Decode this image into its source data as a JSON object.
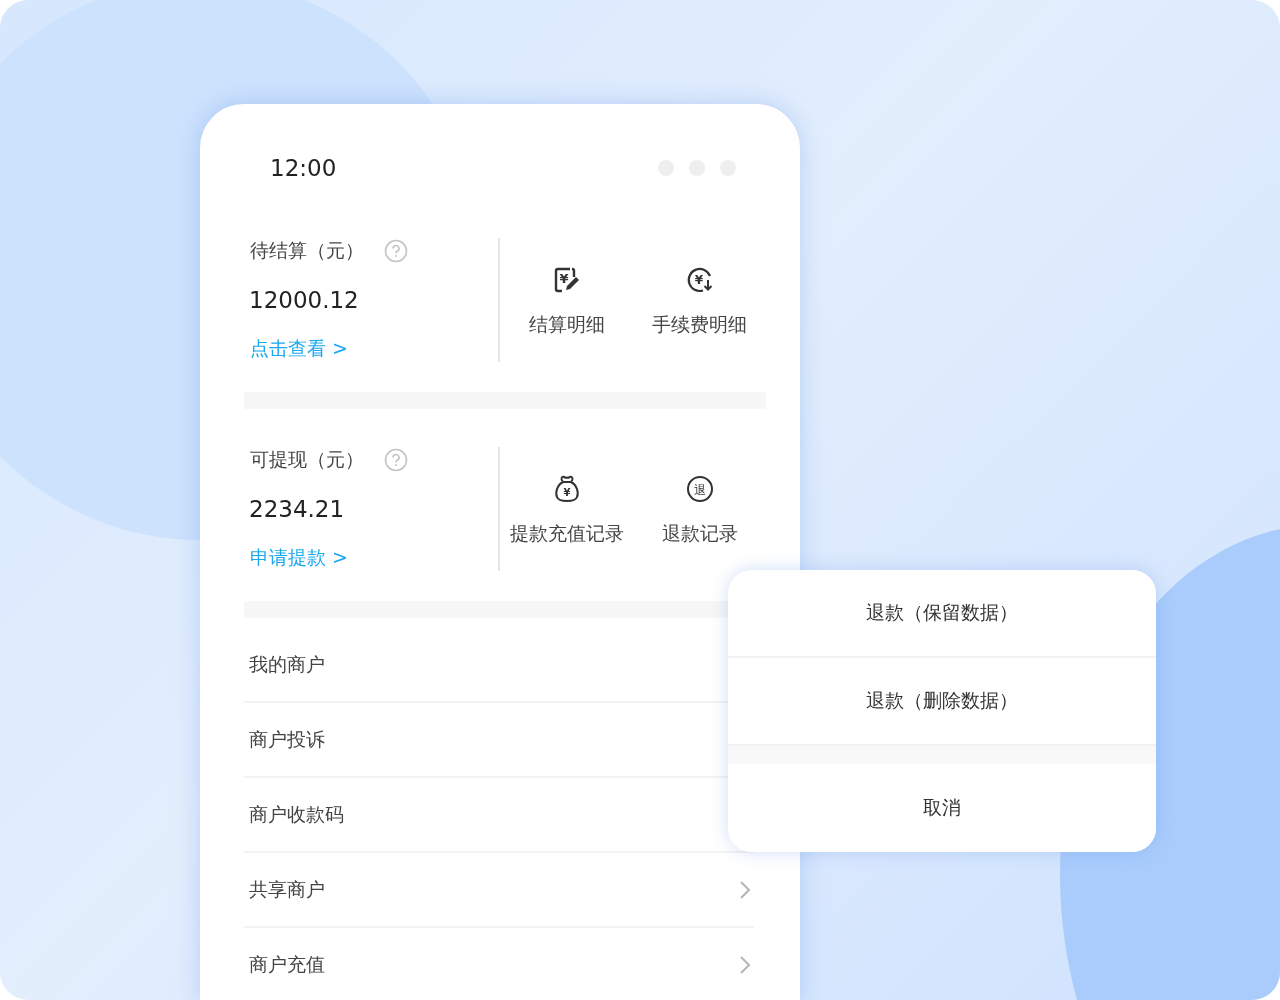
{
  "status_bar": {
    "time": "12:00"
  },
  "sections": [
    {
      "title": "待结算（元）",
      "amount": "12000.12",
      "link": "点击查看 >",
      "shortcuts": [
        {
          "label": "结算明细",
          "kind": "receipt",
          "glyph": "¥"
        },
        {
          "label": "手续费明细",
          "kind": "cycle",
          "glyph": "¥"
        }
      ]
    },
    {
      "title": "可提现（元）",
      "amount": "2234.21",
      "link": "申请提款 >",
      "shortcuts": [
        {
          "label": "提款充值记录",
          "kind": "bag",
          "glyph": "¥"
        },
        {
          "label": "退款记录",
          "kind": "circle",
          "glyph": "退"
        }
      ]
    }
  ],
  "menu": [
    {
      "label": "我的商户"
    },
    {
      "label": "商户投诉"
    },
    {
      "label": "商户收款码"
    },
    {
      "label": "共享商户",
      "arrow": true
    },
    {
      "label": "商户充值",
      "arrow": true
    }
  ],
  "action_sheet": {
    "options": [
      "退款（保留数据）",
      "退款（删除数据）"
    ],
    "cancel": "取消"
  }
}
